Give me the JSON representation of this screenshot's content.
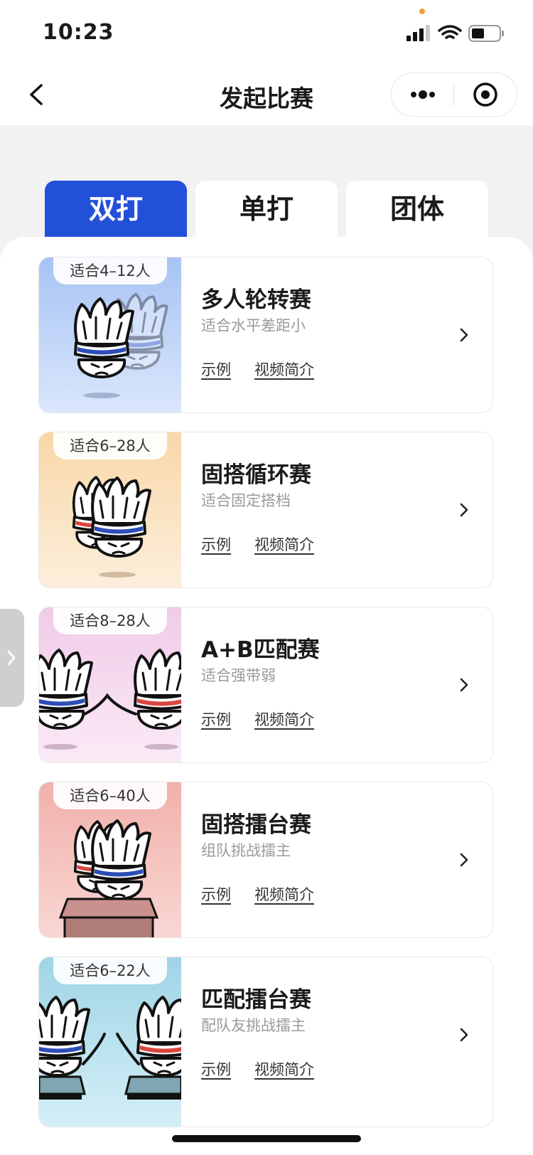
{
  "status_bar": {
    "time": "10:23",
    "icons": [
      "signal-icon",
      "wifi-icon",
      "battery-icon"
    ]
  },
  "nav": {
    "title": "发起比赛",
    "icons": [
      "back-chevron-icon",
      "more-dots-icon",
      "target-icon"
    ]
  },
  "tabs": [
    {
      "label": "双打",
      "active": true
    },
    {
      "label": "单打",
      "active": false
    },
    {
      "label": "团体",
      "active": false
    }
  ],
  "cards": [
    {
      "badge": "适合4–12人",
      "title": "多人轮转赛",
      "subtitle": "适合水平差距小",
      "example": "示例",
      "video": "视频简介",
      "thumb_colors": [
        "#a7c3f4",
        "#dbe7fc"
      ]
    },
    {
      "badge": "适合6–28人",
      "title": "固搭循环赛",
      "subtitle": "适合固定搭档",
      "example": "示例",
      "video": "视频简介",
      "thumb_colors": [
        "#f8d7a8",
        "#fcefdc"
      ]
    },
    {
      "badge": "适合8–28人",
      "title": "A+B匹配赛",
      "subtitle": "适合强带弱",
      "example": "示例",
      "video": "视频简介",
      "thumb_colors": [
        "#f0cbe8",
        "#fbeaf6"
      ]
    },
    {
      "badge": "适合6–40人",
      "title": "固搭擂台赛",
      "subtitle": "组队挑战擂主",
      "example": "示例",
      "video": "视频简介",
      "thumb_colors": [
        "#f2b0ab",
        "#f9d7d3"
      ]
    },
    {
      "badge": "适合6–22人",
      "title": "匹配擂台赛",
      "subtitle": "配队友挑战擂主",
      "example": "示例",
      "video": "视频简介",
      "thumb_colors": [
        "#9fd4e6",
        "#d5eff7"
      ]
    }
  ],
  "colors": {
    "accent": "#2350d8",
    "headband_blue": "#2d4db8",
    "headband_red": "#d9463e"
  }
}
